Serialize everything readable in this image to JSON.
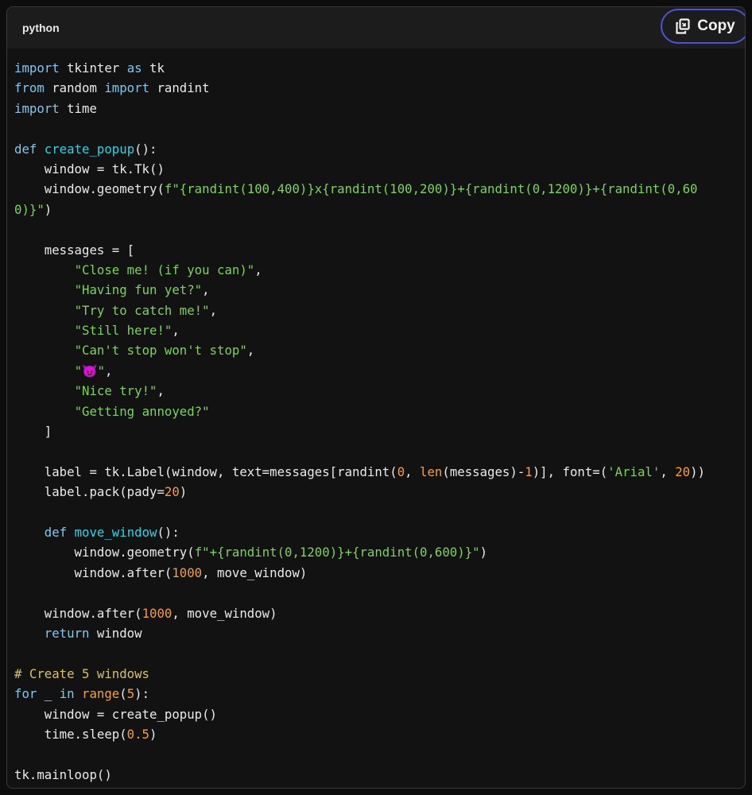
{
  "header": {
    "language": "python",
    "copy_label": "Copy"
  },
  "code": {
    "language": "python",
    "lines": [
      [
        [
          "kw",
          "import"
        ],
        [
          "tx",
          " tkinter "
        ],
        [
          "kw",
          "as"
        ],
        [
          "tx",
          " tk"
        ]
      ],
      [
        [
          "kw",
          "from"
        ],
        [
          "tx",
          " random "
        ],
        [
          "kw",
          "import"
        ],
        [
          "tx",
          " randint"
        ]
      ],
      [
        [
          "kw",
          "import"
        ],
        [
          "tx",
          " time"
        ]
      ],
      [],
      [
        [
          "kw",
          "def"
        ],
        [
          "tx",
          " "
        ],
        [
          "fn",
          "create_popup"
        ],
        [
          "tx",
          "():"
        ]
      ],
      [
        [
          "tx",
          "    window = tk.Tk()"
        ]
      ],
      [
        [
          "tx",
          "    window.geometry("
        ],
        [
          "st",
          "f\"{randint(100,400)}x{randint(100,200)}+{randint(0,1200)}+{randint(0,60"
        ]
      ],
      [
        [
          "st",
          "0)}\""
        ],
        [
          "tx",
          ")"
        ]
      ],
      [],
      [
        [
          "tx",
          "    messages = ["
        ]
      ],
      [
        [
          "tx",
          "        "
        ],
        [
          "st",
          "\"Close me! (if you can)\""
        ],
        [
          "tx",
          ","
        ]
      ],
      [
        [
          "tx",
          "        "
        ],
        [
          "st",
          "\"Having fun yet?\""
        ],
        [
          "tx",
          ","
        ]
      ],
      [
        [
          "tx",
          "        "
        ],
        [
          "st",
          "\"Try to catch me!\""
        ],
        [
          "tx",
          ","
        ]
      ],
      [
        [
          "tx",
          "        "
        ],
        [
          "st",
          "\"Still here!\""
        ],
        [
          "tx",
          ","
        ]
      ],
      [
        [
          "tx",
          "        "
        ],
        [
          "st",
          "\"Can't stop won't stop\""
        ],
        [
          "tx",
          ","
        ]
      ],
      [
        [
          "tx",
          "        "
        ],
        [
          "st",
          "\"😈\""
        ],
        [
          "tx",
          ","
        ]
      ],
      [
        [
          "tx",
          "        "
        ],
        [
          "st",
          "\"Nice try!\""
        ],
        [
          "tx",
          ","
        ]
      ],
      [
        [
          "tx",
          "        "
        ],
        [
          "st",
          "\"Getting annoyed?\""
        ]
      ],
      [
        [
          "tx",
          "    ]"
        ]
      ],
      [],
      [
        [
          "tx",
          "    label = tk.Label(window, text=messages[randint("
        ],
        [
          "nm",
          "0"
        ],
        [
          "tx",
          ", "
        ],
        [
          "bi",
          "len"
        ],
        [
          "tx",
          "(messages)-"
        ],
        [
          "nm",
          "1"
        ],
        [
          "tx",
          ")], font=("
        ],
        [
          "st",
          "'Arial'"
        ],
        [
          "tx",
          ", "
        ],
        [
          "nm",
          "20"
        ],
        [
          "tx",
          "))"
        ]
      ],
      [
        [
          "tx",
          "    label.pack(pady="
        ],
        [
          "nm",
          "20"
        ],
        [
          "tx",
          ")"
        ]
      ],
      [],
      [
        [
          "tx",
          "    "
        ],
        [
          "kw",
          "def"
        ],
        [
          "tx",
          " "
        ],
        [
          "fn",
          "move_window"
        ],
        [
          "tx",
          "():"
        ]
      ],
      [
        [
          "tx",
          "        window.geometry("
        ],
        [
          "st",
          "f\"+{randint(0,1200)}+{randint(0,600)}\""
        ],
        [
          "tx",
          ")"
        ]
      ],
      [
        [
          "tx",
          "        window.after("
        ],
        [
          "nm",
          "1000"
        ],
        [
          "tx",
          ", move_window)"
        ]
      ],
      [],
      [
        [
          "tx",
          "    window.after("
        ],
        [
          "nm",
          "1000"
        ],
        [
          "tx",
          ", move_window)"
        ]
      ],
      [
        [
          "tx",
          "    "
        ],
        [
          "kw",
          "return"
        ],
        [
          "tx",
          " window"
        ]
      ],
      [],
      [
        [
          "cm",
          "# Create 5 windows"
        ]
      ],
      [
        [
          "kw",
          "for"
        ],
        [
          "tx",
          " _ "
        ],
        [
          "kw",
          "in"
        ],
        [
          "tx",
          " "
        ],
        [
          "bi",
          "range"
        ],
        [
          "tx",
          "("
        ],
        [
          "nm",
          "5"
        ],
        [
          "tx",
          "):"
        ]
      ],
      [
        [
          "tx",
          "    window = create_popup()"
        ]
      ],
      [
        [
          "tx",
          "    time.sleep("
        ],
        [
          "nm",
          "0.5"
        ],
        [
          "tx",
          ")"
        ]
      ],
      [],
      [
        [
          "tx",
          "tk.mainloop()"
        ]
      ]
    ]
  },
  "colors": {
    "background": "#121212",
    "header": "#1c1c1c",
    "copy_border": "#4b53d6",
    "keyword": "#7fc8f0",
    "function": "#2fd4e2",
    "string": "#7dd35b",
    "number": "#f29e3d",
    "comment": "#d6c06a"
  }
}
